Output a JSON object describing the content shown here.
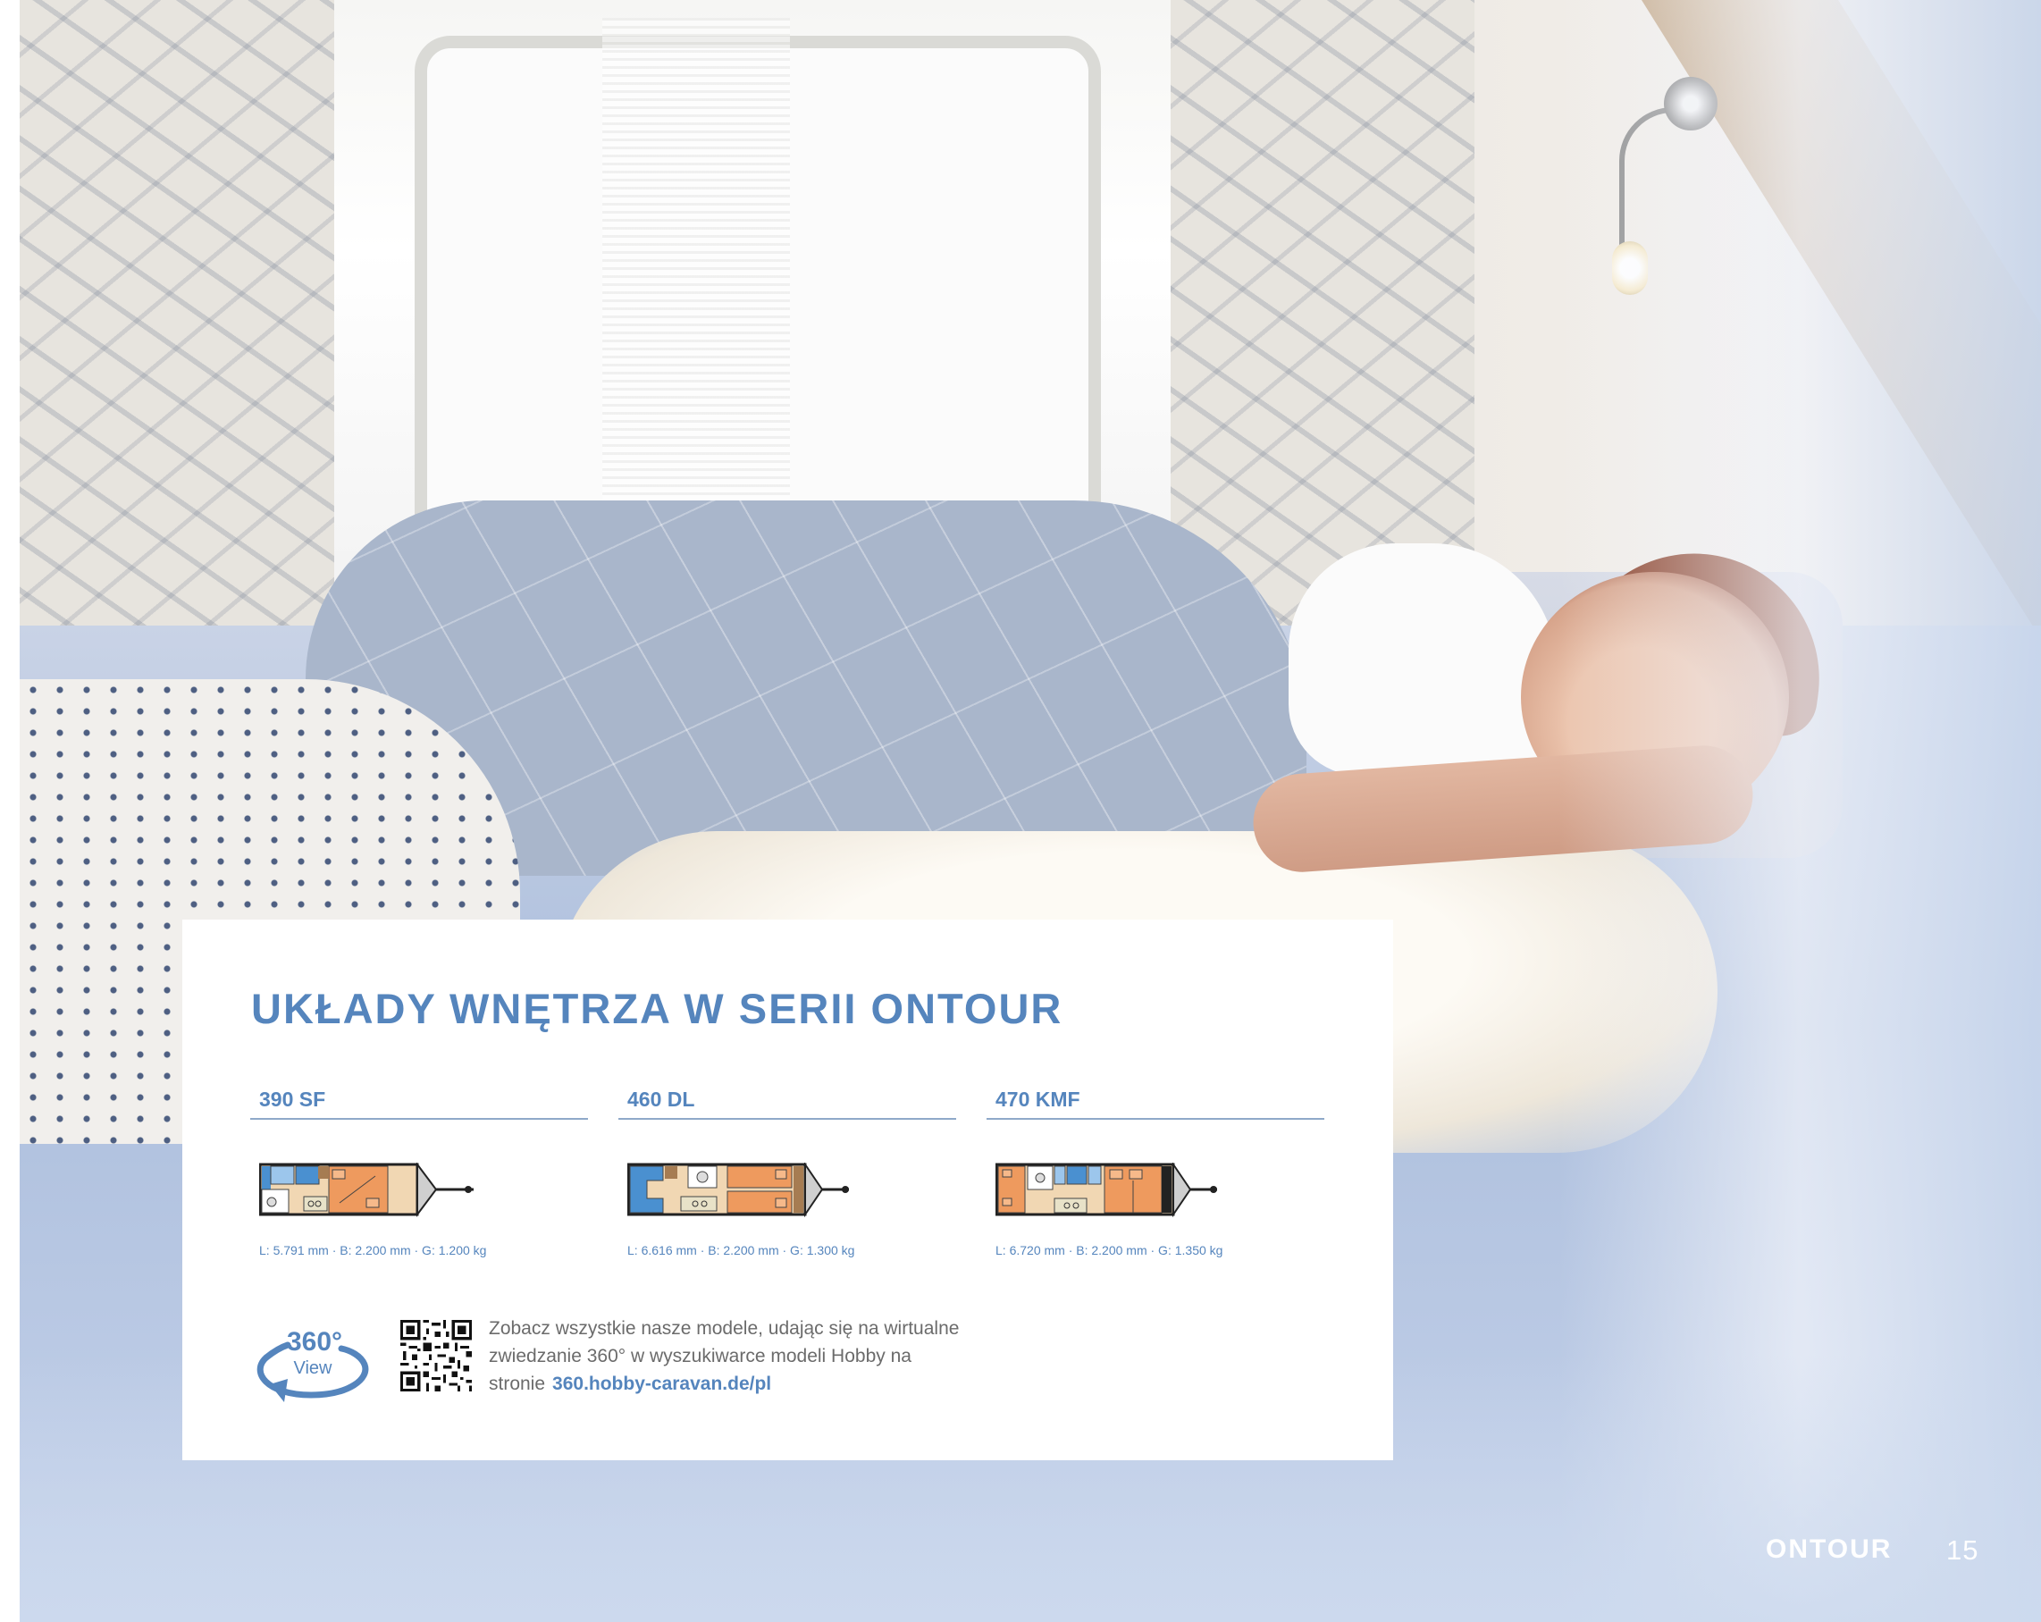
{
  "section_title": "UKŁADY WNĘTRZA W SERII ONTOUR",
  "models": [
    {
      "name": "390 SF",
      "specs": "L: 5.791 mm · B: 2.200 mm · G: 1.200 kg"
    },
    {
      "name": "460 DL",
      "specs": "L: 6.616 mm · B: 2.200 mm · G: 1.300 kg"
    },
    {
      "name": "470 KMF",
      "specs": "L: 6.720 mm · B: 2.200 mm · G: 1.350 kg"
    }
  ],
  "view360": {
    "number": "360°",
    "label": "View"
  },
  "promo": {
    "text": "Zobacz wszystkie nasze modele, udając się na wirtualne zwiedzanie 360° w wyszukiwarce modeli Hobby na stronie",
    "link": "360.hobby-caravan.de/pl"
  },
  "footer": {
    "brand": "ONTOUR",
    "page_number": "15"
  },
  "colors": {
    "accent": "#5585bd",
    "rule": "#8fa9c9",
    "bed_orange": "#ee9a5e",
    "seat_blue": "#4a90d0",
    "floor_beige": "#f1d7b3"
  }
}
